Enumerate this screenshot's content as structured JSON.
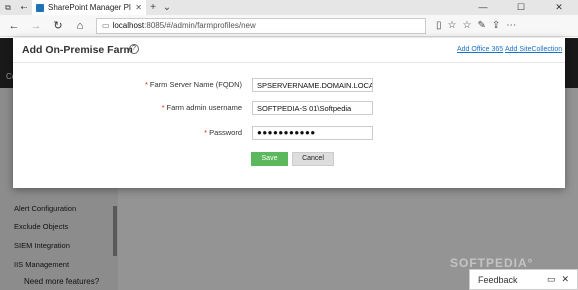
{
  "browser": {
    "tab_title": "SharePoint Manager Plu",
    "url_host": "localhost",
    "url_path": ":8085/#/admin/farmprofiles/new"
  },
  "app": {
    "header_partial": "Co",
    "sidebar_items": [
      "Alert Configuration",
      "Exclude Objects",
      "SIEM Integration",
      "IIS Management",
      "Need more features?"
    ],
    "feedback_label": "Feedback",
    "watermark": "SOFTPEDIA°"
  },
  "modal": {
    "title": "Add On-Premise Farm",
    "link_office365": "Add Office 365",
    "link_sitecollection": "Add SiteCollection",
    "fields": [
      {
        "label": "Farm Server Name (FQDN)",
        "value": "SPSERVERNAME.DOMAIN.LOCAL"
      },
      {
        "label": "Farm admin username",
        "value": "SOFTPEDIA-S 01\\Softpedia"
      },
      {
        "label": "Password",
        "value": "●●●●●●●●●●●"
      }
    ],
    "save_label": "Save",
    "cancel_label": "Cancel"
  }
}
